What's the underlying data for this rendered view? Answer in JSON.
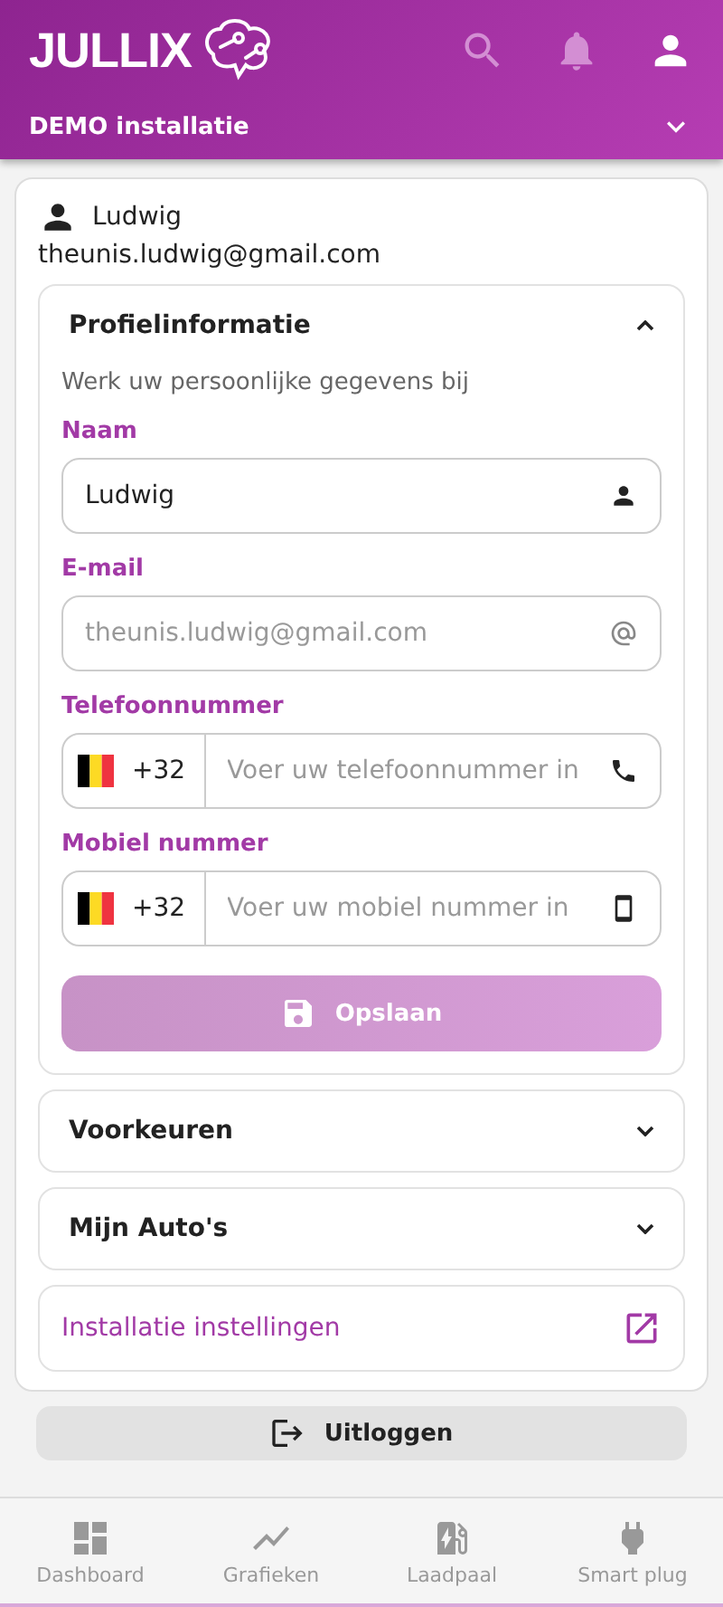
{
  "header": {
    "logo": "JULLIX",
    "installation": "DEMO installatie"
  },
  "user": {
    "name": "Ludwig",
    "email": "theunis.ludwig@gmail.com"
  },
  "sections": [
    {
      "kind": "form",
      "title": "Profielinformatie",
      "expanded": true,
      "subtitle": "Werk uw persoonlijke gegevens bij",
      "fields": [
        {
          "kind": "text",
          "label": "Naam",
          "value": "Ludwig",
          "disabled": false
        },
        {
          "kind": "text",
          "label": "E-mail",
          "value": "theunis.ludwig@gmail.com",
          "disabled": true
        },
        {
          "kind": "phone",
          "label": "Telefoonnummer",
          "prefix": "+32",
          "placeholder": "Voer uw telefoonnummer in"
        },
        {
          "kind": "phone",
          "label": "Mobiel nummer",
          "prefix": "+32",
          "placeholder": "Voer uw mobiel nummer in"
        }
      ],
      "save": {
        "label": "Opslaan",
        "disabled": true
      }
    },
    {
      "kind": "collapsed",
      "title": "Voorkeuren",
      "expanded": false
    },
    {
      "kind": "collapsed",
      "title": "Mijn Auto's",
      "expanded": false
    },
    {
      "kind": "link",
      "title": "Installatie instellingen"
    }
  ],
  "logout": "Uitloggen",
  "nav": [
    {
      "label": "Dashboard",
      "selected": false
    },
    {
      "label": "Grafieken",
      "selected": false
    },
    {
      "label": "Laadpaal",
      "selected": false
    },
    {
      "label": "Smart plug",
      "selected": false
    }
  ]
}
